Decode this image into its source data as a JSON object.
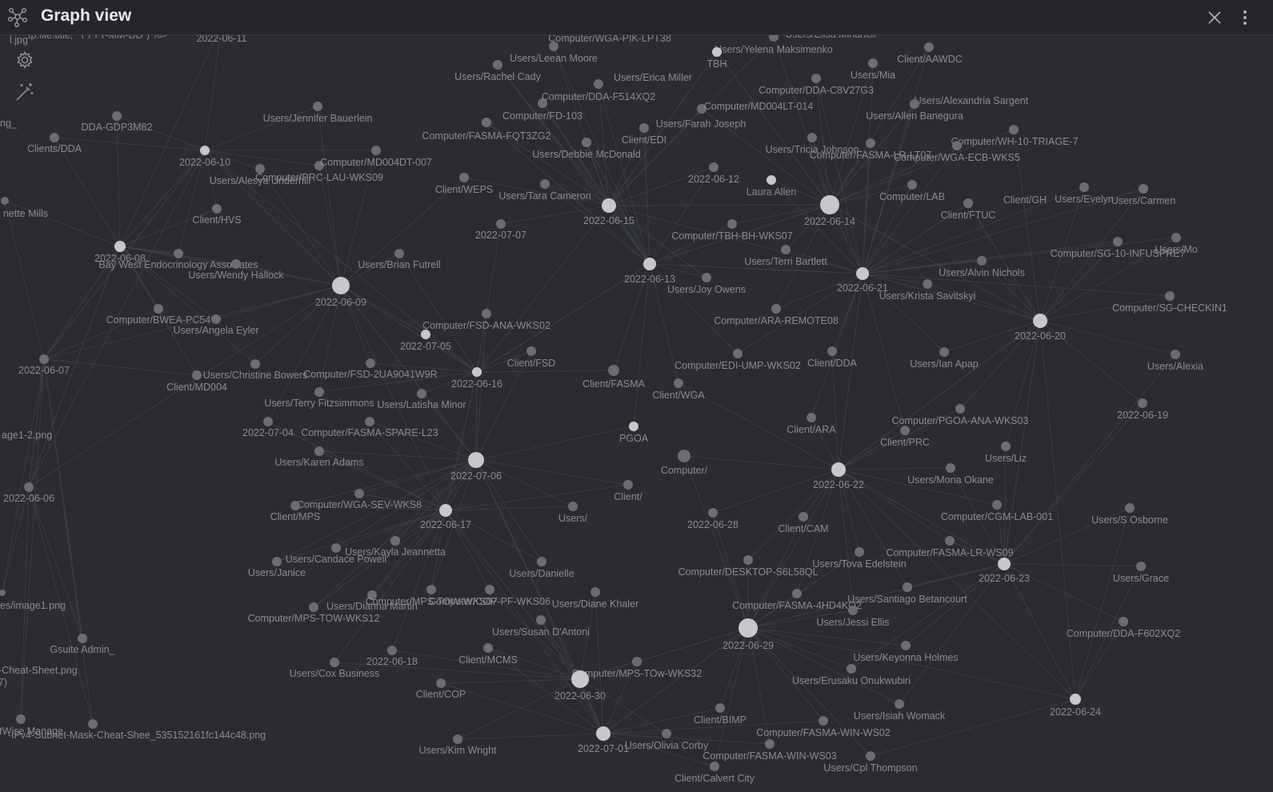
{
  "header": {
    "title": "Graph view",
    "icon": "graph-icon",
    "close_icon": "close-icon",
    "more_icon": "more-vertical-icon"
  },
  "controls": {
    "settings_icon": "gear-icon",
    "animate_icon": "magic-wand-icon"
  },
  "colors": {
    "background": "#2a2b33",
    "node": "#6b6c75",
    "hub": "#c8c8cc",
    "edge": "#3f4049",
    "label": "#8a8b94"
  },
  "graph": {
    "nodes": [
      {
        "id": "n0",
        "label": "l.jpg"
      },
      {
        "id": "n1",
        "label": "tp.file.title, \"YYYY-MM-DD\") %>"
      },
      {
        "id": "n2",
        "label": "2022-06-11"
      },
      {
        "id": "n3",
        "label": "ng_"
      },
      {
        "id": "n4",
        "label": "nette Mills"
      },
      {
        "id": "n5",
        "label": "age1-2.png"
      },
      {
        "id": "n6",
        "label": "es/image1.png"
      },
      {
        "id": "n7",
        "label": "-Cheat-Sheet.png"
      },
      {
        "id": "n8",
        "label": "7)"
      },
      {
        "id": "n9",
        "label": "ctWise Manage"
      },
      {
        "id": "n10",
        "label": "-IPv4-Subnet-Mask-Cheat-Shee_535152161fc144c48.png"
      },
      {
        "id": "n11",
        "label": "DDA-GDP3M82"
      },
      {
        "id": "n12",
        "label": "Clients/DDA"
      },
      {
        "id": "n13",
        "label": "2022-06-10"
      },
      {
        "id": "n14",
        "label": "Users/Jennifer Bauerlein"
      },
      {
        "id": "n15",
        "label": "Users/Alesya Underhill"
      },
      {
        "id": "n16",
        "label": "Computer/PRC-LAU-WKS09"
      },
      {
        "id": "n17",
        "label": "Computer/MD004DT-007"
      },
      {
        "id": "n18",
        "label": "Client/HVS"
      },
      {
        "id": "n19",
        "label": "2022-06-08"
      },
      {
        "id": "n20",
        "label": "Bay West Endocrinology Associates"
      },
      {
        "id": "n21",
        "label": "Users/Wendy Hallock"
      },
      {
        "id": "n22",
        "label": "2022-06-09"
      },
      {
        "id": "n23",
        "label": "Users/Brian Futrell"
      },
      {
        "id": "n24",
        "label": "Computer/BWEA-PC54"
      },
      {
        "id": "n25",
        "label": "Users/Angela Eyler"
      },
      {
        "id": "n26",
        "label": "2022-06-07"
      },
      {
        "id": "n27",
        "label": "Client/MD004"
      },
      {
        "id": "n28",
        "label": "Users/Christine Bowers"
      },
      {
        "id": "n29",
        "label": "Computer/FSD-2UA9041W9R"
      },
      {
        "id": "n30",
        "label": "Users/Terry Fitzsimmons"
      },
      {
        "id": "n31",
        "label": "Users/Latisha Minor"
      },
      {
        "id": "n32",
        "label": "2022-07-04"
      },
      {
        "id": "n33",
        "label": "Computer/FASMA-SPARE-L23"
      },
      {
        "id": "n34",
        "label": "Users/Karen Adams"
      },
      {
        "id": "n35",
        "label": "2022-06-06"
      },
      {
        "id": "n36",
        "label": "Computer/WGA-SEV-WKS8"
      },
      {
        "id": "n37",
        "label": "Client/MPS"
      },
      {
        "id": "n38",
        "label": "Users/Kayla Jeannetta"
      },
      {
        "id": "n39",
        "label": "Users/Candace Powell"
      },
      {
        "id": "n40",
        "label": "Users/Janice"
      },
      {
        "id": "n41",
        "label": "Users/Dianna Martin"
      },
      {
        "id": "n42",
        "label": "Computer/MPS-TOW-WKS12"
      },
      {
        "id": "n43",
        "label": "Gsuite Admin_"
      },
      {
        "id": "n44",
        "label": "Users/Cox Business"
      },
      {
        "id": "n45",
        "label": "2022-06-18"
      },
      {
        "id": "n46",
        "label": "Client/COP"
      },
      {
        "id": "n47",
        "label": "Users/Kim Wright"
      },
      {
        "id": "n48",
        "label": "Computer/WGA-PIK-LPT38"
      },
      {
        "id": "n49",
        "label": "Users/Leean Moore"
      },
      {
        "id": "n50",
        "label": "Users/Rachel Cady"
      },
      {
        "id": "n51",
        "label": "Users/Erica Miller"
      },
      {
        "id": "n52",
        "label": "Computer/DDA-F514XQ2"
      },
      {
        "id": "n53",
        "label": "Computer/FD-103"
      },
      {
        "id": "n54",
        "label": "Computer/FASMA-FQT3ZG2"
      },
      {
        "id": "n55",
        "label": "Users/Debbie McDonald"
      },
      {
        "id": "n56",
        "label": "Client/WEPS"
      },
      {
        "id": "n57",
        "label": "Users/Tara Cameron"
      },
      {
        "id": "n58",
        "label": "2022-06-15"
      },
      {
        "id": "n59",
        "label": "2022-07-07"
      },
      {
        "id": "n60",
        "label": "Users/Elisa Minarick"
      },
      {
        "id": "n61",
        "label": "Users/Yelena Maksimenko"
      },
      {
        "id": "n62",
        "label": "TBH"
      },
      {
        "id": "n63",
        "label": "Client/AAWDC"
      },
      {
        "id": "n64",
        "label": "Users/Mia"
      },
      {
        "id": "n65",
        "label": "Computer/DDA-C8V27G3"
      },
      {
        "id": "n66",
        "label": "Computer/MD004LT-014"
      },
      {
        "id": "n67",
        "label": "Users/Farah Joseph"
      },
      {
        "id": "n68",
        "label": "Users/Alexandria Sargent"
      },
      {
        "id": "n69",
        "label": "Users/Allen Banegura"
      },
      {
        "id": "n70",
        "label": "Client/EDI"
      },
      {
        "id": "n71",
        "label": "Users/Tricia Johnson"
      },
      {
        "id": "n72",
        "label": "Computer/FASMA-LR-LT07"
      },
      {
        "id": "n73",
        "label": "Computer/WH-10-TRIAGE-7"
      },
      {
        "id": "n74",
        "label": "Computer/WGA-ECB-WKS5"
      },
      {
        "id": "n75",
        "label": "2022-06-12"
      },
      {
        "id": "n76",
        "label": "Laura Allen"
      },
      {
        "id": "n77",
        "label": "2022-06-14"
      },
      {
        "id": "n78",
        "label": "Computer/LAB"
      },
      {
        "id": "n79",
        "label": "Client/GH"
      },
      {
        "id": "n80",
        "label": "Users/Evelyn"
      },
      {
        "id": "n81",
        "label": "Users/Carmen"
      },
      {
        "id": "n82",
        "label": "Client/FTUC"
      },
      {
        "id": "n83",
        "label": "Computer/TBH-BH-WKS07"
      },
      {
        "id": "n84",
        "label": "Users/Terri Bartlett"
      },
      {
        "id": "n85",
        "label": "Computer/SG-10-INFUSPRE7"
      },
      {
        "id": "n86",
        "label": "Users/Mo"
      },
      {
        "id": "n87",
        "label": "2022-06-13"
      },
      {
        "id": "n88",
        "label": "Users/Joy Owens"
      },
      {
        "id": "n89",
        "label": "2022-06-21"
      },
      {
        "id": "n90",
        "label": "Users/Alvin Nichols"
      },
      {
        "id": "n91",
        "label": "Users/Krista Savitskyi"
      },
      {
        "id": "n92",
        "label": "Computer/SG-CHECKIN1"
      },
      {
        "id": "n93",
        "label": "Computer/FSD-ANA-WKS02"
      },
      {
        "id": "n94",
        "label": "2022-07-05"
      },
      {
        "id": "n95",
        "label": "Computer/ARA-REMOTE08"
      },
      {
        "id": "n96",
        "label": "2022-06-20"
      },
      {
        "id": "n97",
        "label": "Client/FSD"
      },
      {
        "id": "n98",
        "label": "2022-06-16"
      },
      {
        "id": "n99",
        "label": "Computer/EDI-UMP-WKS02"
      },
      {
        "id": "n100",
        "label": "Client/DDA"
      },
      {
        "id": "n101",
        "label": "Users/Ian Apap"
      },
      {
        "id": "n102",
        "label": "Users/Alexia"
      },
      {
        "id": "n103",
        "label": "Client/FASMA"
      },
      {
        "id": "n104",
        "label": "Client/WGA"
      },
      {
        "id": "n105",
        "label": "2022-06-19"
      },
      {
        "id": "n106",
        "label": "Computer/PGOA-ANA-WKS03"
      },
      {
        "id": "n107",
        "label": "PGOA"
      },
      {
        "id": "n108",
        "label": "Client/ARA"
      },
      {
        "id": "n109",
        "label": "Client/PRC"
      },
      {
        "id": "n110",
        "label": "Users/Liz"
      },
      {
        "id": "n111",
        "label": "2022-07-06"
      },
      {
        "id": "n112",
        "label": "Computer/"
      },
      {
        "id": "n113",
        "label": "2022-06-22"
      },
      {
        "id": "n114",
        "label": "Users/Mona Okane"
      },
      {
        "id": "n115",
        "label": "2022-06-17"
      },
      {
        "id": "n116",
        "label": "Client/"
      },
      {
        "id": "n117",
        "label": "Users/"
      },
      {
        "id": "n118",
        "label": "2022-06-28"
      },
      {
        "id": "n119",
        "label": "Client/CAM"
      },
      {
        "id": "n120",
        "label": "Computer/CGM-LAB-001"
      },
      {
        "id": "n121",
        "label": "Users/S Osborne"
      },
      {
        "id": "n122",
        "label": "Users/Danielle"
      },
      {
        "id": "n123",
        "label": "Users/Tova Edelstein"
      },
      {
        "id": "n124",
        "label": "Computer/FASMA-LR-WS09"
      },
      {
        "id": "n125",
        "label": "Computer/DESKTOP-S6L58QL"
      },
      {
        "id": "n126",
        "label": "2022-06-23"
      },
      {
        "id": "n127",
        "label": "Users/Grace"
      },
      {
        "id": "n128",
        "label": "Computer/MPS-TOW-WKS07"
      },
      {
        "id": "n129",
        "label": "Computer/COP-PF-WKS06"
      },
      {
        "id": "n130",
        "label": "Users/Diane Khaler"
      },
      {
        "id": "n131",
        "label": "Users/Santiago Betancourt"
      },
      {
        "id": "n132",
        "label": "Computer/FASMA-4HD4KQ2"
      },
      {
        "id": "n133",
        "label": "Users/Susan D'Antoni"
      },
      {
        "id": "n134",
        "label": "Users/Jessi Ellis"
      },
      {
        "id": "n135",
        "label": "2022-06-29"
      },
      {
        "id": "n136",
        "label": "Computer/DDA-F602XQ2"
      },
      {
        "id": "n137",
        "label": "Client/MCMS"
      },
      {
        "id": "n138",
        "label": "Users/Keyonna Holmes"
      },
      {
        "id": "n139",
        "label": "Computer/MPS-TOw-WKS32"
      },
      {
        "id": "n140",
        "label": "2022-06-30"
      },
      {
        "id": "n141",
        "label": "Users/Erusaku Onukwubiri"
      },
      {
        "id": "n142",
        "label": "Users/Isiah Womack"
      },
      {
        "id": "n143",
        "label": "2022-06-24"
      },
      {
        "id": "n144",
        "label": "Client/BIMP"
      },
      {
        "id": "n145",
        "label": "Computer/FASMA-WIN-WS02"
      },
      {
        "id": "n146",
        "label": "2022-07-01"
      },
      {
        "id": "n147",
        "label": "Users/Olivia Corby"
      },
      {
        "id": "n148",
        "label": "Computer/FASMA-WIN-WS03"
      },
      {
        "id": "n149",
        "label": "Users/Cpl Thompson"
      },
      {
        "id": "n150",
        "label": "Client/Calvert City"
      }
    ]
  }
}
